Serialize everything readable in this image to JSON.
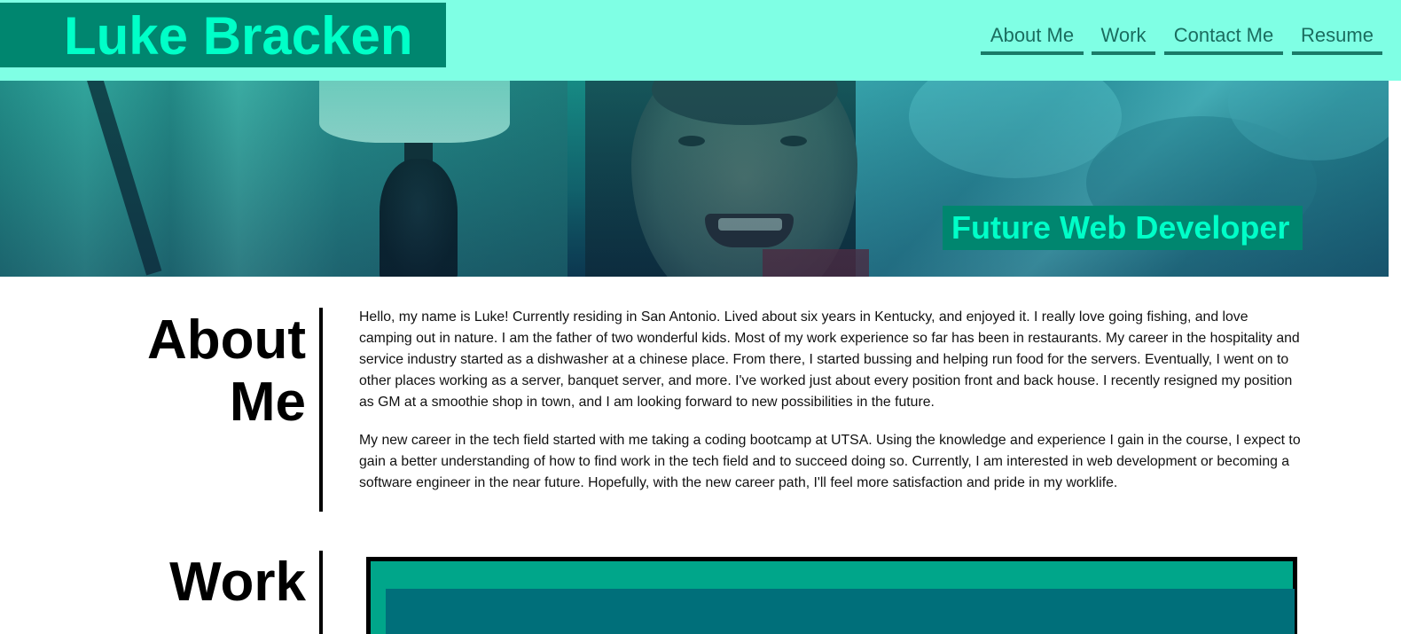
{
  "header": {
    "brand_name": "Luke Bracken",
    "nav": [
      {
        "label": "About Me"
      },
      {
        "label": "Work"
      },
      {
        "label": "Contact Me"
      },
      {
        "label": "Resume"
      }
    ]
  },
  "hero": {
    "tagline": "Future Web Developer"
  },
  "about": {
    "title_line1": "About",
    "title_line2": "Me",
    "paragraphs": [
      "Hello, my name is Luke! Currently residing in San Antonio. Lived about six years in Kentucky, and enjoyed it. I really love going fishing, and love camping out in nature. I am the father of two wonderful kids. Most of my work experience so far has been in restaurants. My career in the hospitality and service industry started as a dishwasher at a chinese place. From there, I started bussing and helping run food for the servers. Eventually, I went on to other places working as a server, banquet server, and more. I've worked just about every position front and back house. I recently resigned my position as GM at a smoothie shop in town, and I am looking forward to new possibilities in the future.",
      "My new career in the tech field started with me taking a coding bootcamp at UTSA. Using the knowledge and experience I gain in the course, I expect to gain a better understanding of how to find work in the tech field and to succeed doing so. Currently, I am interested in web development or becoming a software engineer in the near future. Hopefully, with the new career path, I'll feel more satisfaction and pride in my worklife."
    ]
  },
  "work": {
    "title": "Work"
  },
  "colors": {
    "header_bg": "#7fffe4",
    "brand_bg": "#00866f",
    "brand_text": "#00ffc8",
    "nav_text": "#1a6d5f"
  }
}
